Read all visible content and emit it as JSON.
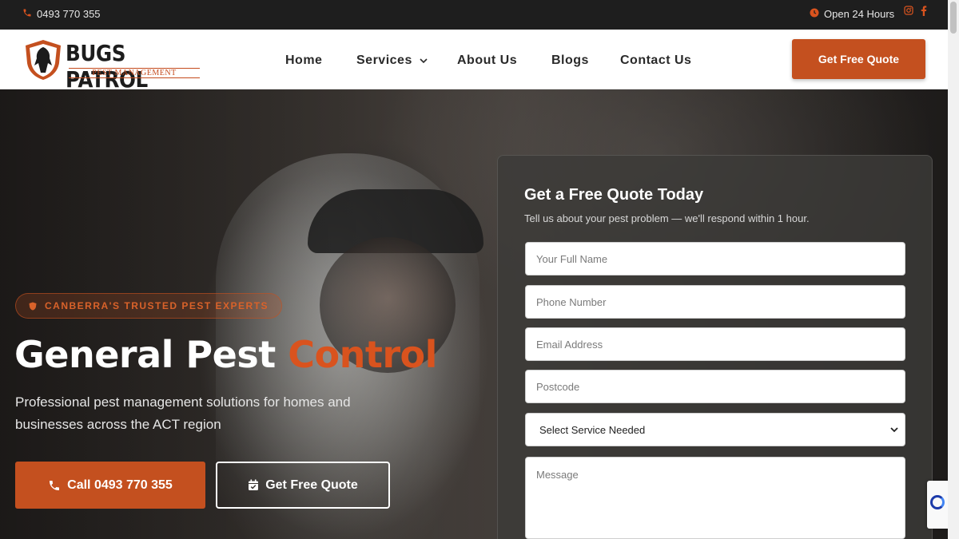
{
  "topbar": {
    "phone": "0493 770 355",
    "hours": "Open 24 Hours",
    "social": [
      "instagram-icon",
      "facebook-icon"
    ]
  },
  "header": {
    "logo_brand": "BUGS PATROL",
    "logo_sub": "PEST MANAGEMENT",
    "nav": [
      "Home",
      "Services",
      "About Us",
      "Blogs",
      "Contact Us"
    ],
    "cta": "Get Free Quote"
  },
  "hero": {
    "badge": "CANBERRA'S TRUSTED PEST EXPERTS",
    "title_main": "General Pest",
    "title_accent": "Control",
    "description": "Professional pest management solutions for homes and businesses across the ACT region",
    "call_button": "Call 0493 770 355",
    "quote_button": "Get Free Quote"
  },
  "form": {
    "title": "Get a Free Quote Today",
    "subtitle": "Tell us about your pest problem — we'll respond within 1 hour.",
    "name_placeholder": "Your Full Name",
    "phone_placeholder": "Phone Number",
    "email_placeholder": "Email Address",
    "postcode_placeholder": "Postcode",
    "service_selected": "Select Service Needed",
    "message_placeholder": "Message"
  },
  "colors": {
    "accent": "#c4501f",
    "dark": "#1e1e1e"
  }
}
